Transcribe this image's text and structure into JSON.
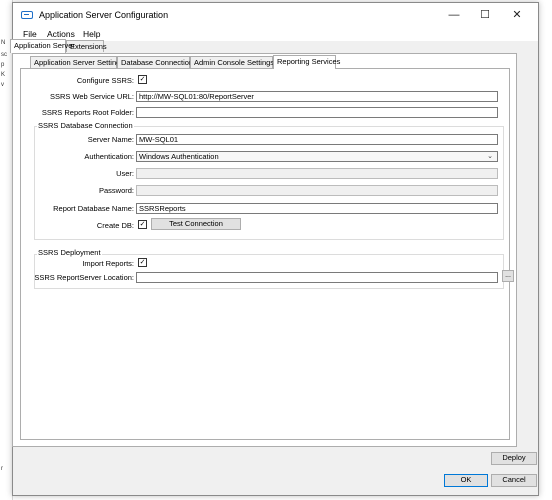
{
  "window": {
    "title": "Application Server Configuration",
    "min": "—",
    "max": "☐",
    "close": "✕"
  },
  "menu": [
    "File",
    "Actions",
    "Help"
  ],
  "outer_tabs": [
    "Application Server",
    "Extensions"
  ],
  "inner_tabs": [
    "Application Server Settings",
    "Database Connection",
    "Admin Console Settings",
    "Reporting Services"
  ],
  "form": {
    "configure_ssrs_label": "Configure SSRS:",
    "web_service_url_label": "SSRS Web Service URL:",
    "web_service_url_value": "http://MW-SQL01:80/ReportServer",
    "root_folder_label": "SSRS Reports Root Folder:",
    "root_folder_value": "",
    "db_group_title": "SSRS Database Connection",
    "server_name_label": "Server Name:",
    "server_name_value": "MW-SQL01",
    "auth_label": "Authentication:",
    "auth_value": "Windows Authentication",
    "user_label": "User:",
    "user_value": "",
    "password_label": "Password:",
    "password_value": "",
    "report_db_label": "Report Database Name:",
    "report_db_value": "SSRSReports",
    "create_db_label": "Create DB:",
    "test_connection": "Test Connection",
    "deploy_group_title": "SSRS Deployment",
    "import_reports_label": "Import Reports:",
    "report_server_location_label": "SSRS ReportServer Location:",
    "report_server_location_value": "",
    "browse": "...",
    "check": "✓"
  },
  "buttons": {
    "deploy": "Deploy",
    "ok": "OK",
    "cancel": "Cancel"
  },
  "behind": [
    "N",
    "sc",
    "p",
    "K",
    "v",
    "r"
  ],
  "colors": {
    "accent": "#0078d7",
    "icon": "#1e6fc9"
  }
}
